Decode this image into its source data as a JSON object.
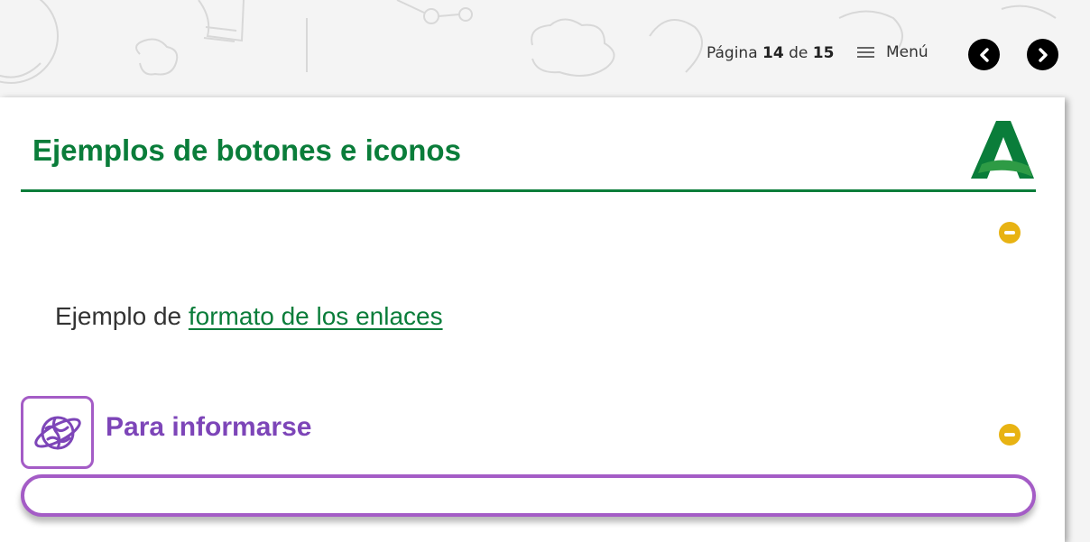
{
  "navigation": {
    "page_prefix": "Página",
    "current_page": "14",
    "page_connector": "de",
    "total_pages": "15",
    "menu_label": "Menú",
    "prev_icon": "chevron-left-icon",
    "next_icon": "chevron-right-icon"
  },
  "card": {
    "title": "Ejemplos de botones e iconos",
    "logo": "junta-andalucia-logo"
  },
  "link_example": {
    "prefix": "Ejemplo de ",
    "link_text": "formato de los enlaces"
  },
  "info_section": {
    "title": "Para informarse",
    "icon": "globe-icon"
  },
  "colors": {
    "brand_green": "#0a7d3a",
    "toggle_yellow": "#e8b313",
    "info_purple": "#a45cc6"
  }
}
